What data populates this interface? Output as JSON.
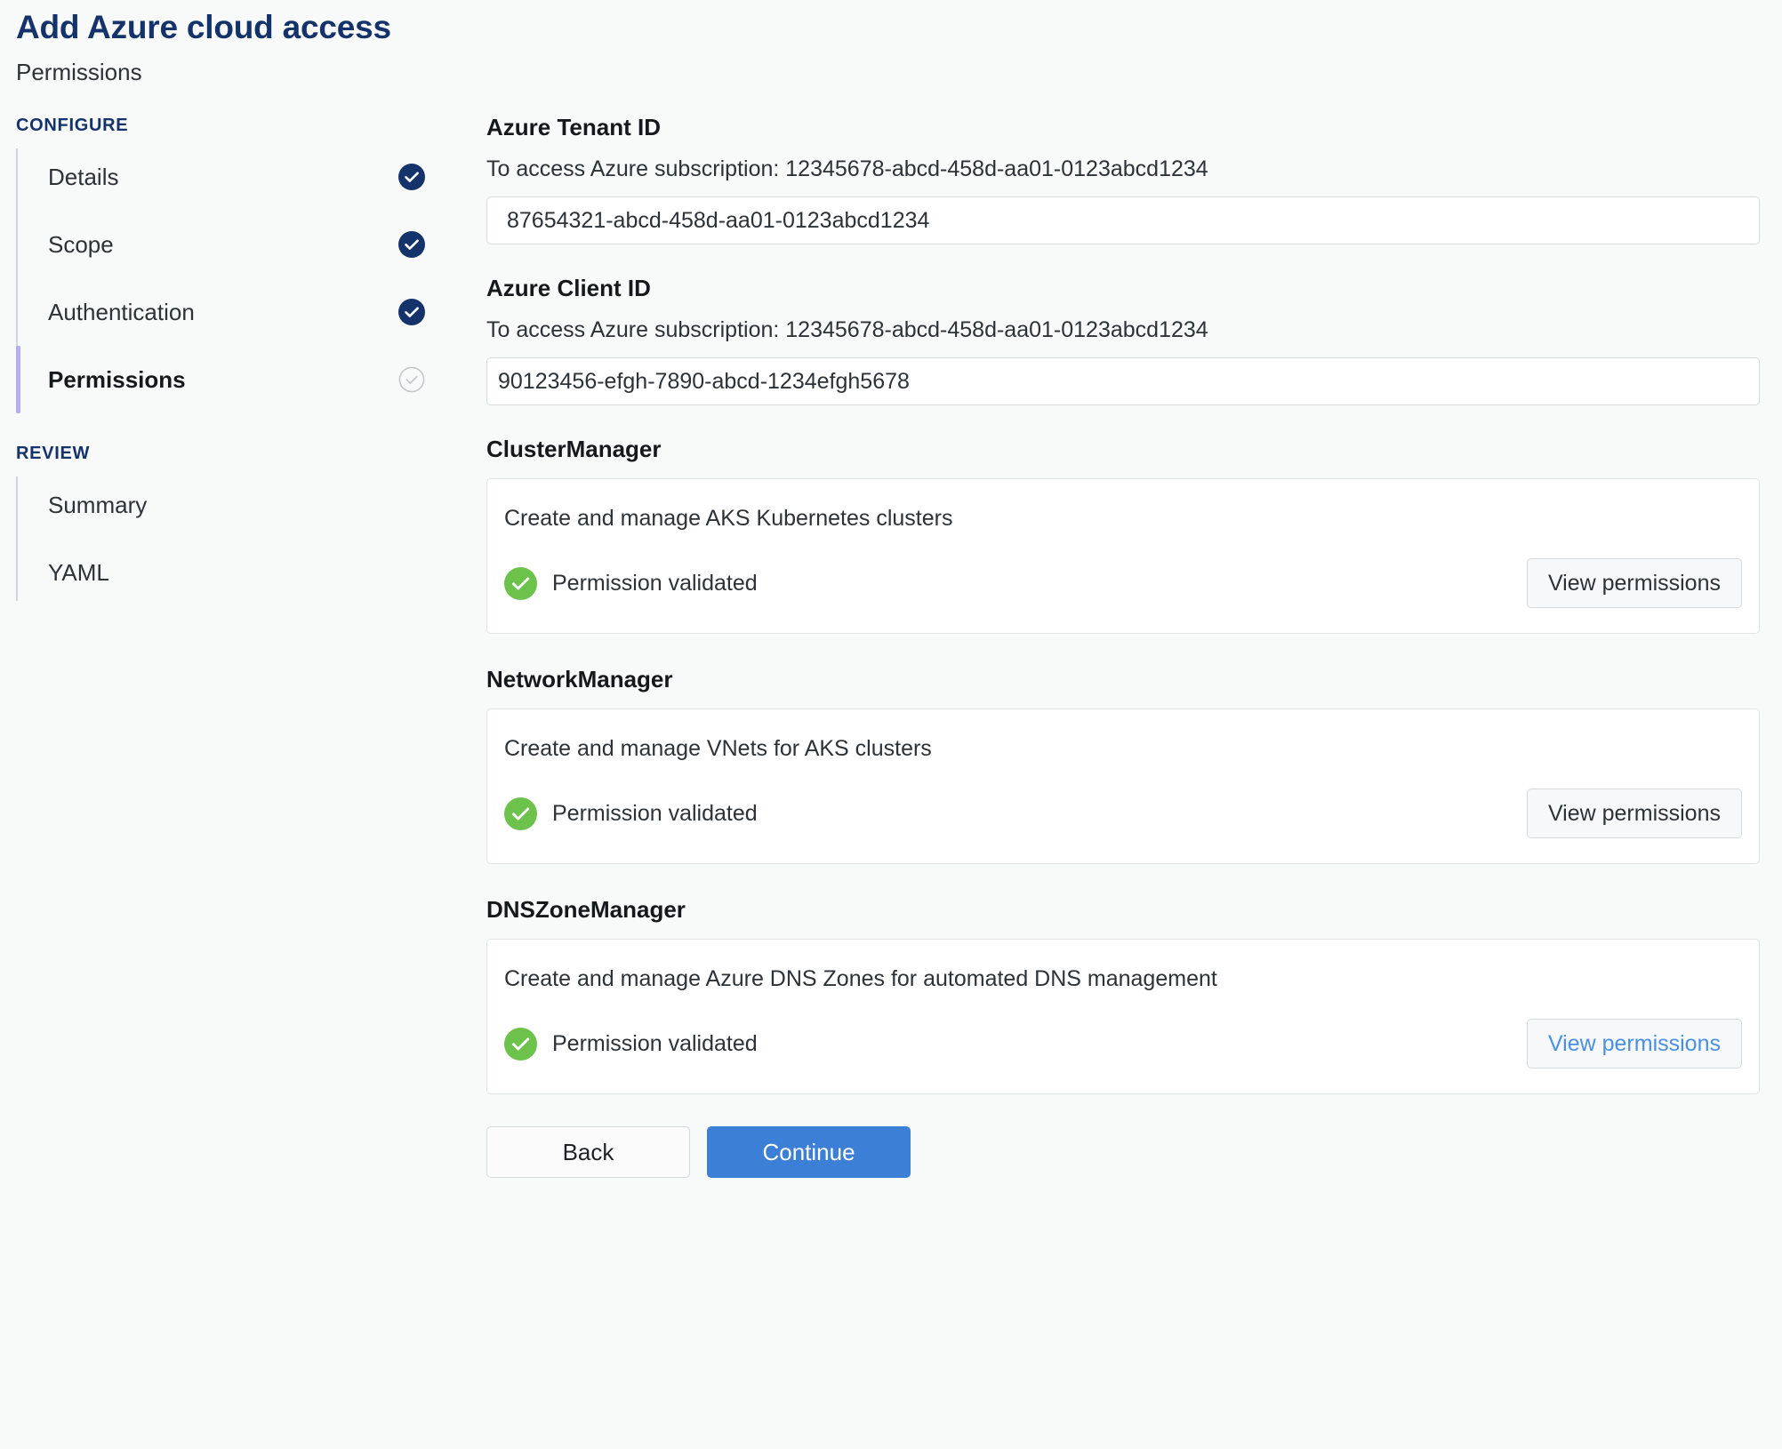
{
  "header": {
    "title": "Add Azure cloud access",
    "subtitle": "Permissions"
  },
  "sidebar": {
    "groups": [
      {
        "label": "CONFIGURE",
        "items": [
          {
            "label": "Details",
            "status": "complete"
          },
          {
            "label": "Scope",
            "status": "complete"
          },
          {
            "label": "Authentication",
            "status": "complete"
          },
          {
            "label": "Permissions",
            "status": "current"
          }
        ]
      },
      {
        "label": "REVIEW",
        "items": [
          {
            "label": "Summary",
            "status": "none"
          },
          {
            "label": "YAML",
            "status": "none"
          }
        ]
      }
    ]
  },
  "main": {
    "fields": [
      {
        "label": "Azure Tenant ID",
        "help": "To access Azure subscription: 12345678-abcd-458d-aa01-0123abcd1234",
        "value": "87654321-abcd-458d-aa01-0123abcd1234"
      },
      {
        "label": "Azure Client ID",
        "help": "To access Azure subscription: 12345678-abcd-458d-aa01-0123abcd1234",
        "value": "90123456-efgh-7890-abcd-1234efgh5678"
      }
    ],
    "permissions": [
      {
        "title": "ClusterManager",
        "description": "Create and manage AKS Kubernetes clusters",
        "status_text": "Permission validated",
        "button_label": "View permissions",
        "button_state": "default"
      },
      {
        "title": "NetworkManager",
        "description": "Create and manage VNets for AKS clusters",
        "status_text": "Permission validated",
        "button_label": "View permissions",
        "button_state": "default"
      },
      {
        "title": "DNSZoneManager",
        "description": "Create and manage Azure DNS Zones for automated DNS management",
        "status_text": "Permission validated",
        "button_label": "View permissions",
        "button_state": "highlighted"
      }
    ],
    "footer": {
      "back_label": "Back",
      "continue_label": "Continue"
    }
  },
  "colors": {
    "title_navy": "#14336b",
    "active_accent": "#b3aef0",
    "check_complete": "#14336b",
    "check_pending": "#c3c7cb",
    "validated_green": "#6cc24a",
    "primary_blue": "#3c7fd6",
    "link_blue": "#4a90e2"
  }
}
